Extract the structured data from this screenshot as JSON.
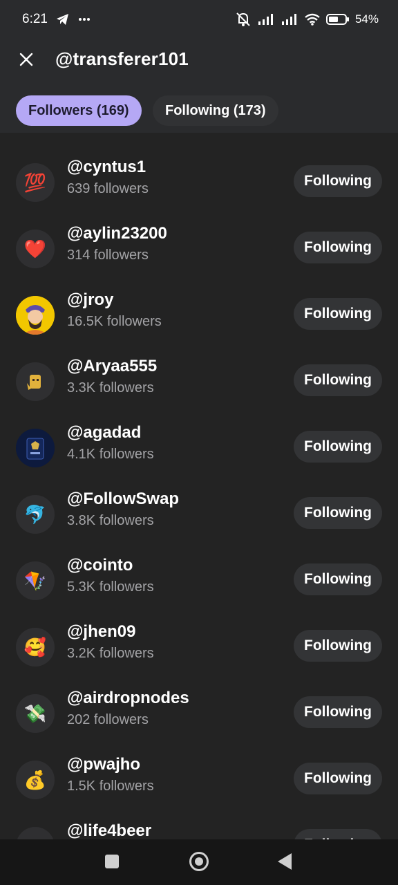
{
  "status_bar": {
    "time": "6:21",
    "battery": "54%",
    "icons": [
      "telegram-icon",
      "more-dots-icon",
      "mute-icon",
      "signal-icon",
      "signal-icon",
      "wifi-icon",
      "battery-icon"
    ]
  },
  "header": {
    "title": "@transferer101",
    "close_icon": "close-icon"
  },
  "tabs": [
    {
      "label": "Followers (169)",
      "active": true
    },
    {
      "label": "Following (173)",
      "active": false
    }
  ],
  "rows": [
    {
      "username": "@cyntus1",
      "followers": "639 followers",
      "avatar": "💯",
      "button": "Following"
    },
    {
      "username": "@aylin23200",
      "followers": "314 followers",
      "avatar": "❤️",
      "button": "Following"
    },
    {
      "username": "@jroy",
      "followers": "16.5K followers",
      "avatar": "image",
      "button": "Following"
    },
    {
      "username": "@Aryaa555",
      "followers": "3.3K followers",
      "avatar": "image",
      "button": "Following"
    },
    {
      "username": "@agadad",
      "followers": "4.1K followers",
      "avatar": "image",
      "button": "Following"
    },
    {
      "username": "@FollowSwap",
      "followers": "3.8K followers",
      "avatar": "🐬",
      "button": "Following"
    },
    {
      "username": "@cointo",
      "followers": "5.3K followers",
      "avatar": "🪁",
      "button": "Following"
    },
    {
      "username": "@jhen09",
      "followers": "3.2K followers",
      "avatar": "🥰",
      "button": "Following"
    },
    {
      "username": "@airdropnodes",
      "followers": "202 followers",
      "avatar": "💸",
      "button": "Following"
    },
    {
      "username": "@pwajho",
      "followers": "1.5K followers",
      "avatar": "💰",
      "button": "Following"
    },
    {
      "username": "@life4beer",
      "followers": "",
      "avatar": "",
      "button": "Following"
    }
  ],
  "colors": {
    "accent": "#b5a8f5",
    "background": "#232323",
    "header": "#2a2b2d",
    "button": "#333436",
    "secondary_text": "#a3a3a6"
  },
  "nav": {
    "icons": [
      "recents-square-icon",
      "home-circle-icon",
      "back-triangle-icon"
    ]
  }
}
